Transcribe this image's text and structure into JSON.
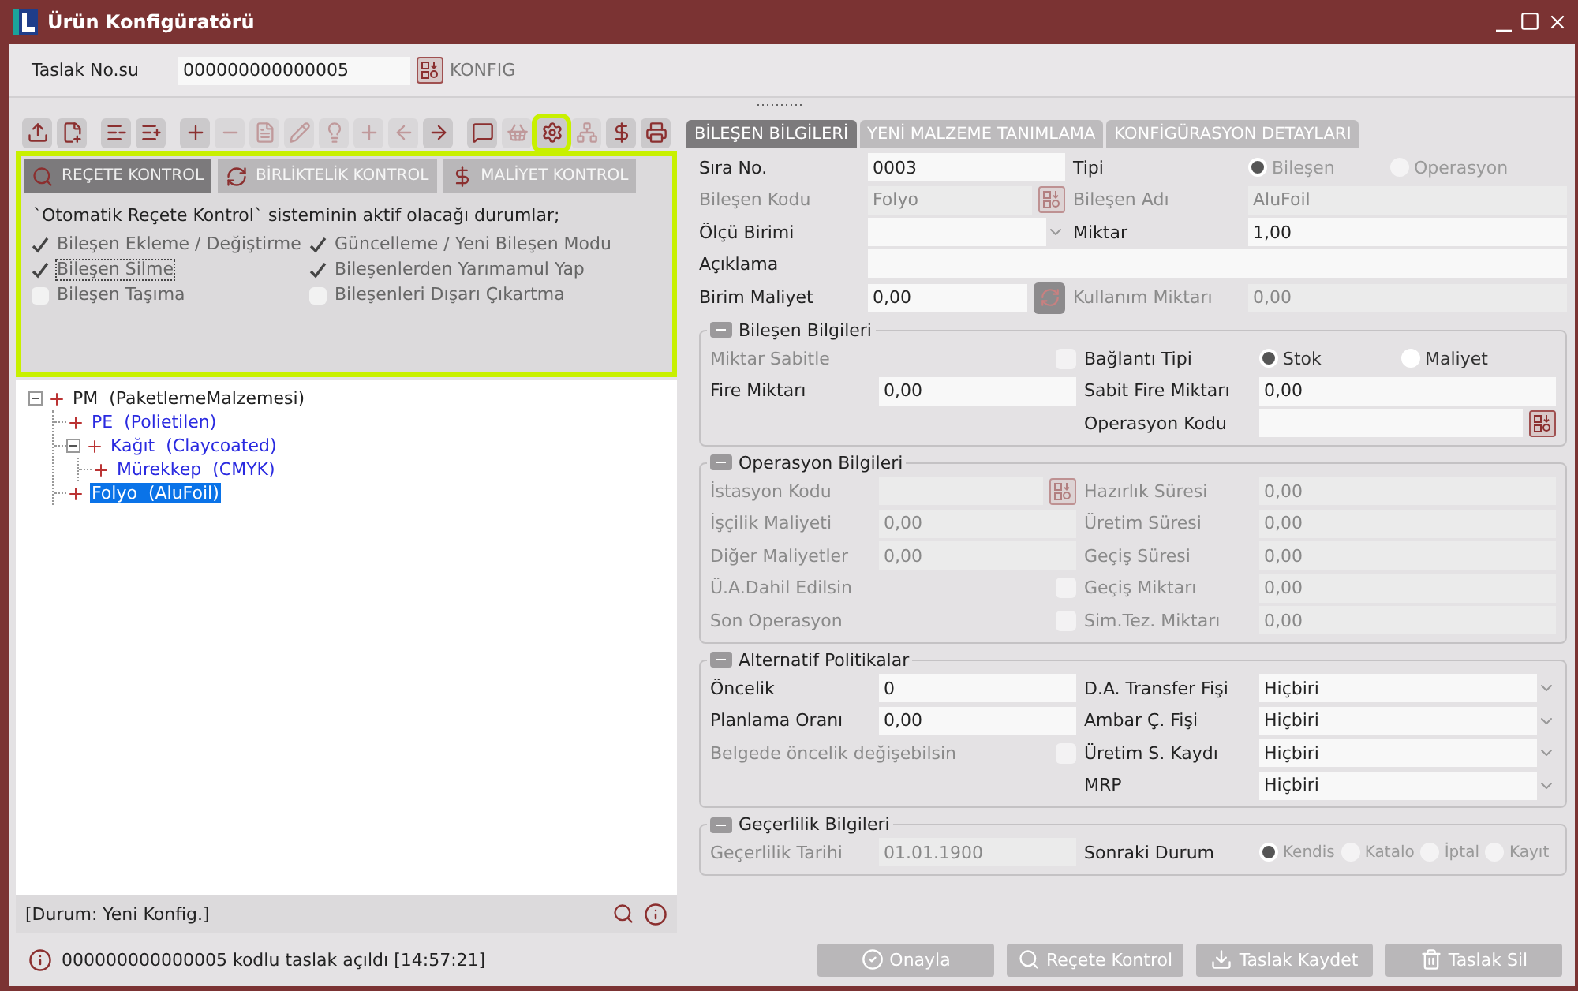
{
  "window": {
    "title": "Ürün Konfigüratörü"
  },
  "draft": {
    "label": "Taslak No.su",
    "value": "000000000000005",
    "action": "KONFIG"
  },
  "toolbar": {
    "groups": [
      {
        "buttons": [
          {
            "kind": "upload",
            "disabled": false,
            "highlighted": false
          },
          {
            "kind": "add-doc",
            "disabled": false,
            "highlighted": false
          }
        ]
      },
      {
        "buttons": [
          {
            "kind": "tree-remove",
            "disabled": false,
            "highlighted": false
          },
          {
            "kind": "tree-add",
            "disabled": false,
            "highlighted": false
          }
        ]
      },
      {
        "buttons": [
          {
            "kind": "add",
            "disabled": false,
            "highlighted": false
          },
          {
            "kind": "remove",
            "disabled": true,
            "highlighted": false
          },
          {
            "kind": "document",
            "disabled": true,
            "highlighted": false
          },
          {
            "kind": "edit",
            "disabled": true,
            "highlighted": false
          },
          {
            "kind": "hint",
            "disabled": true,
            "highlighted": false
          },
          {
            "kind": "insert",
            "disabled": true,
            "highlighted": false
          },
          {
            "kind": "back",
            "disabled": true,
            "highlighted": false
          },
          {
            "kind": "forward",
            "disabled": false,
            "highlighted": false
          }
        ]
      },
      {
        "buttons": [
          {
            "kind": "comment",
            "disabled": false,
            "highlighted": false
          },
          {
            "kind": "basket",
            "disabled": true,
            "highlighted": false
          },
          {
            "kind": "settings",
            "disabled": false,
            "highlighted": true
          },
          {
            "kind": "hierarchy",
            "disabled": true,
            "highlighted": false
          },
          {
            "kind": "cost",
            "disabled": false,
            "highlighted": false
          },
          {
            "kind": "print",
            "disabled": false,
            "highlighted": false
          }
        ]
      }
    ]
  },
  "control_tabs": [
    {
      "label": "REÇETE KONTROL",
      "kind": "recipe",
      "selected": true
    },
    {
      "label": "BİRLİKTELİK KONTROL",
      "kind": "link",
      "selected": false
    },
    {
      "label": "MALİYET KONTROL",
      "kind": "cost",
      "selected": false
    }
  ],
  "control_panel": {
    "heading": "`Otomatik Reçete Kontrol`  sisteminin aktif olacağı durumlar;",
    "checks": [
      {
        "label": "Bileşen Ekleme / Değiştirme",
        "checked": true,
        "focused": false
      },
      {
        "label": "Güncelleme / Yeni Bileşen Modu",
        "checked": true,
        "focused": false
      },
      {
        "label": "Bileşen Silme",
        "checked": true,
        "focused": true
      },
      {
        "label": "Bileşenlerden Yarımamul Yap",
        "checked": true,
        "focused": false
      },
      {
        "label": "Bileşen Taşıma",
        "checked": false,
        "focused": false
      },
      {
        "label": "Bileşenleri Dışarı Çıkartma",
        "checked": false,
        "focused": false
      }
    ]
  },
  "tree": [
    {
      "label": "PM  (PaketlemeMalzemesi)",
      "selected": false,
      "expanded": true,
      "children": [
        {
          "label": "PE  (Polietilen)",
          "selected": false
        },
        {
          "label": "Kağıt  (Claycoated)",
          "selected": false,
          "expanded": true,
          "children": [
            {
              "label": "Mürekkep  (CMYK)",
              "selected": false
            }
          ]
        },
        {
          "label": "Folyo  (AluFoil)",
          "selected": true
        }
      ]
    }
  ],
  "status": "[Durum: Yeni Konfig.]",
  "detail_tabs": [
    {
      "label": "BİLEŞEN BİLGİLERİ",
      "selected": true
    },
    {
      "label": "YENİ MALZEME TANIMLAMA",
      "selected": false
    },
    {
      "label": "KONFİGÜRASYON DETAYLARI",
      "selected": false
    }
  ],
  "form": {
    "rows": [
      {
        "left": {
          "label": "Sıra No.",
          "kind": "text",
          "value": "0003",
          "disabled": false
        },
        "right": {
          "label": "Tipi",
          "kind": "radio",
          "options": [
            {
              "label": "Bileşen",
              "selected": true,
              "disabled": true
            },
            {
              "label": "Operasyon",
              "selected": false,
              "disabled": true
            }
          ]
        }
      },
      {
        "left": {
          "label": "Bileşen Kodu",
          "kind": "lookup",
          "value": "Folyo",
          "disabled": true
        },
        "right": {
          "label": "Bileşen Adı",
          "kind": "text",
          "value": "AluFoil",
          "disabled": true
        }
      },
      {
        "left": {
          "label": "Ölçü Birimi",
          "kind": "select",
          "disabled": false
        },
        "right": {
          "label": "Miktar",
          "kind": "text",
          "value": "1,00",
          "disabled": false
        }
      },
      {
        "left": {
          "label": "Açıklama",
          "kind": "wide",
          "disabled": false
        }
      },
      {
        "left": {
          "label": "Birim Maliyet",
          "kind": "refresh",
          "value": "0,00",
          "disabled": false
        },
        "right": {
          "label": "Kullanım Miktarı",
          "kind": "text",
          "value": "0,00",
          "disabled": true
        }
      }
    ],
    "sections": [
      {
        "title": "Bileşen Bilgileri",
        "expanded": true,
        "rows": [
          {
            "left": {
              "label": "Miktar Sabitle",
              "kind": "checkbox",
              "checked": false,
              "disabled": true
            },
            "right": {
              "label": "Bağlantı Tipi",
              "kind": "radio",
              "options": [
                {
                  "label": "Stok",
                  "selected": true,
                  "disabled": false
                },
                {
                  "label": "Maliyet",
                  "selected": false,
                  "disabled": false
                }
              ]
            }
          },
          {
            "left": {
              "label": "Fire Miktarı",
              "kind": "text",
              "value": "0,00",
              "disabled": false
            },
            "right": {
              "label": "Sabit Fire Miktarı",
              "kind": "text",
              "value": "0,00",
              "disabled": false
            }
          },
          {
            "right": {
              "label": "Operasyon Kodu",
              "kind": "lookup",
              "disabled": false
            }
          }
        ]
      },
      {
        "title": "Operasyon Bilgileri",
        "expanded": true,
        "rows": [
          {
            "left": {
              "label": "İstasyon Kodu",
              "kind": "lookup",
              "disabled": true
            },
            "right": {
              "label": "Hazırlık Süresi",
              "kind": "text",
              "value": "0,00",
              "disabled": true
            }
          },
          {
            "left": {
              "label": "İşçilik Maliyeti",
              "kind": "text",
              "value": "0,00",
              "disabled": true
            },
            "right": {
              "label": "Üretim Süresi",
              "kind": "text",
              "value": "0,00",
              "disabled": true
            }
          },
          {
            "left": {
              "label": "Diğer Maliyetler",
              "kind": "text",
              "value": "0,00",
              "disabled": true
            },
            "right": {
              "label": "Geçiş Süresi",
              "kind": "text",
              "value": "0,00",
              "disabled": true
            }
          },
          {
            "left": {
              "label": "Ü.A.Dahil Edilsin",
              "kind": "checkbox",
              "checked": false,
              "disabled": true
            },
            "right": {
              "label": "Geçiş Miktarı",
              "kind": "text",
              "value": "0,00",
              "disabled": true
            }
          },
          {
            "left": {
              "label": "Son Operasyon",
              "kind": "checkbox",
              "checked": false,
              "disabled": true
            },
            "right": {
              "label": "Sim.Tez. Miktarı",
              "kind": "text",
              "value": "0,00",
              "disabled": true
            }
          }
        ]
      },
      {
        "title": "Alternatif Politikalar",
        "expanded": true,
        "rows": [
          {
            "left": {
              "label": "Öncelik",
              "kind": "text",
              "value": "0",
              "disabled": false
            },
            "right": {
              "label": "D.A. Transfer Fişi",
              "kind": "select",
              "value": "Hiçbiri",
              "disabled": false
            }
          },
          {
            "left": {
              "label": "Planlama Oranı",
              "kind": "text",
              "value": "0,00",
              "disabled": false
            },
            "right": {
              "label": "Ambar Ç. Fişi",
              "kind": "select",
              "value": "Hiçbiri",
              "disabled": false
            }
          },
          {
            "left": {
              "label": "Belgede öncelik değişebilsin",
              "kind": "checkbox",
              "checked": false,
              "disabled": true
            },
            "right": {
              "label": "Üretim S. Kaydı",
              "kind": "select",
              "value": "Hiçbiri",
              "disabled": false
            }
          },
          {
            "right": {
              "label": "MRP",
              "kind": "select",
              "value": "Hiçbiri",
              "disabled": false
            }
          }
        ]
      },
      {
        "title": "Geçerlilik Bilgileri",
        "expanded": true,
        "rows": [
          {
            "left": {
              "label": "Geçerlilik Tarihi",
              "kind": "text",
              "value": "01.01.1900",
              "disabled": true
            },
            "right": {
              "label": "Sonraki Durum",
              "kind": "radio",
              "options": [
                {
                  "label": "Kendis",
                  "selected": true,
                  "disabled": true
                },
                {
                  "label": "Katalo",
                  "selected": false,
                  "disabled": true
                },
                {
                  "label": "İptal",
                  "selected": false,
                  "disabled": true
                },
                {
                  "label": "Kayıt",
                  "selected": false,
                  "disabled": true
                }
              ]
            }
          }
        ]
      }
    ]
  },
  "message": "000000000000005 kodlu taslak açıldı [14:57:21]",
  "actions": [
    {
      "label": "Onayla",
      "kind": "approve"
    },
    {
      "label": "Reçete Kontrol",
      "kind": "check"
    },
    {
      "label": "Taslak Kaydet",
      "kind": "save"
    },
    {
      "label": "Taslak Sil",
      "kind": "delete"
    }
  ]
}
